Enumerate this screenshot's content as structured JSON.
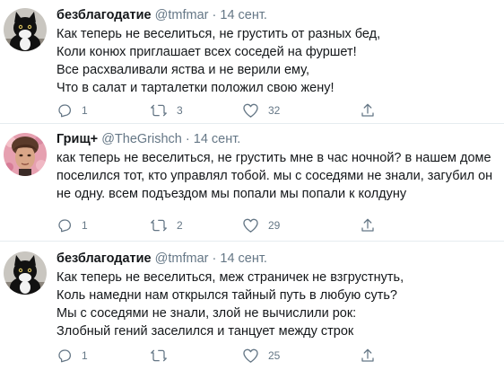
{
  "tweets": [
    {
      "name": "безблагодатие",
      "handle": "@tmfmar",
      "date": "14 сент.",
      "lines": [
        "Как теперь не веселиться, не грустить от разных бед,",
        "Коли конюх приглашает всех соседей на фуршет!",
        "Все расхваливали яства и не верили ему,",
        "Что в салат и тарталетки положил свою жену!"
      ],
      "replies": "1",
      "retweets": "3",
      "likes": "32"
    },
    {
      "name": "Грищ+",
      "handle": "@TheGrishch",
      "date": "14 сент.",
      "lines": [
        "как теперь не веселиться, не грустить мне в час ночной? в нашем доме",
        "поселился тот, кто управлял тобой. мы с соседями не знали, загубил он",
        "не одну. всем подъездом мы попали мы попали к колдуну"
      ],
      "replies": "1",
      "retweets": "2",
      "likes": "29"
    },
    {
      "name": "безблагодатие",
      "handle": "@tmfmar",
      "date": "14 сент.",
      "lines": [
        "Как теперь не веселиться, меж страничек не взгрустнуть,",
        "Коль намедни нам открылся тайный путь в любую суть?",
        "Мы с соседями не знали, злой не вычислили рок:",
        "Злобный гений заселился и танцует между строк"
      ],
      "replies": "1",
      "retweets": "",
      "likes": "25"
    }
  ],
  "separator": "·",
  "icons": {
    "reply": "reply-icon",
    "retweet": "retweet-icon",
    "like": "heart-icon",
    "share": "share-icon"
  },
  "colors": {
    "text": "#14171a",
    "secondary": "#657786",
    "divider": "#e6ecf0"
  }
}
